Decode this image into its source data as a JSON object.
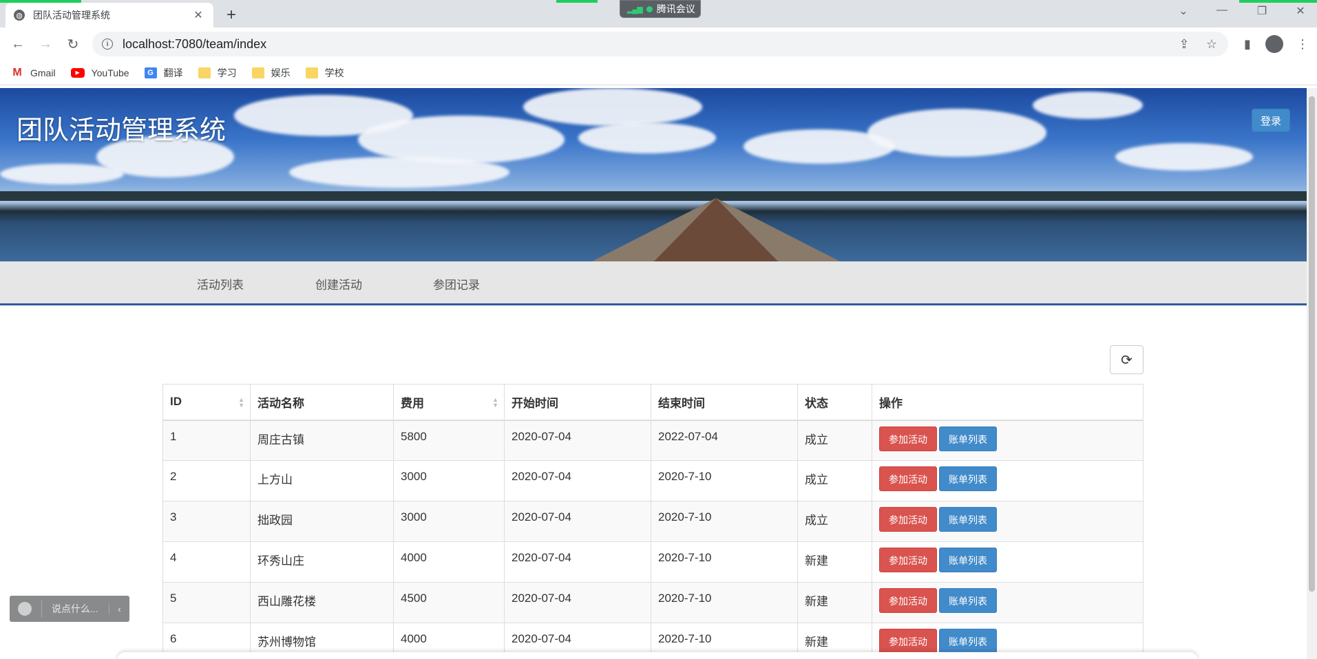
{
  "browser": {
    "tab_title": "团队活动管理系统",
    "tab_close": "✕",
    "new_tab": "+",
    "meeting_label": "腾讯会议",
    "url": "localhost:7080/team/index",
    "bookmarks": [
      {
        "label": "Gmail",
        "icon": "gmail-icon"
      },
      {
        "label": "YouTube",
        "icon": "youtube-icon"
      },
      {
        "label": "翻译",
        "icon": "translate-icon"
      },
      {
        "label": "学习",
        "icon": "folder-icon"
      },
      {
        "label": "娱乐",
        "icon": "folder-icon"
      },
      {
        "label": "学校",
        "icon": "folder-icon"
      }
    ]
  },
  "header": {
    "site_title": "团队活动管理系统",
    "login_label": "登录"
  },
  "nav": {
    "items": [
      "活动列表",
      "创建活动",
      "参团记录"
    ]
  },
  "table": {
    "columns": [
      "ID",
      "活动名称",
      "费用",
      "开始时间",
      "结束时间",
      "状态",
      "操作"
    ],
    "join_label": "参加活动",
    "bills_label": "账单列表",
    "rows": [
      {
        "id": "1",
        "name": "周庄古镇",
        "cost": "5800",
        "start": "2020-07-04",
        "end": "2022-07-04",
        "status": "成立"
      },
      {
        "id": "2",
        "name": "上方山",
        "cost": "3000",
        "start": "2020-07-04",
        "end": "2020-7-10",
        "status": "成立"
      },
      {
        "id": "3",
        "name": "拙政园",
        "cost": "3000",
        "start": "2020-07-04",
        "end": "2020-7-10",
        "status": "成立"
      },
      {
        "id": "4",
        "name": "环秀山庄",
        "cost": "4000",
        "start": "2020-07-04",
        "end": "2020-7-10",
        "status": "新建"
      },
      {
        "id": "5",
        "name": "西山雕花楼",
        "cost": "4500",
        "start": "2020-07-04",
        "end": "2020-7-10",
        "status": "新建"
      },
      {
        "id": "6",
        "name": "苏州博物馆",
        "cost": "4000",
        "start": "2020-07-04",
        "end": "2020-7-10",
        "status": "新建"
      }
    ]
  },
  "chat_widget": {
    "placeholder": "说点什么..."
  },
  "colors": {
    "danger": "#d9534f",
    "primary": "#428bca",
    "nav_border": "#2b5b9e"
  }
}
